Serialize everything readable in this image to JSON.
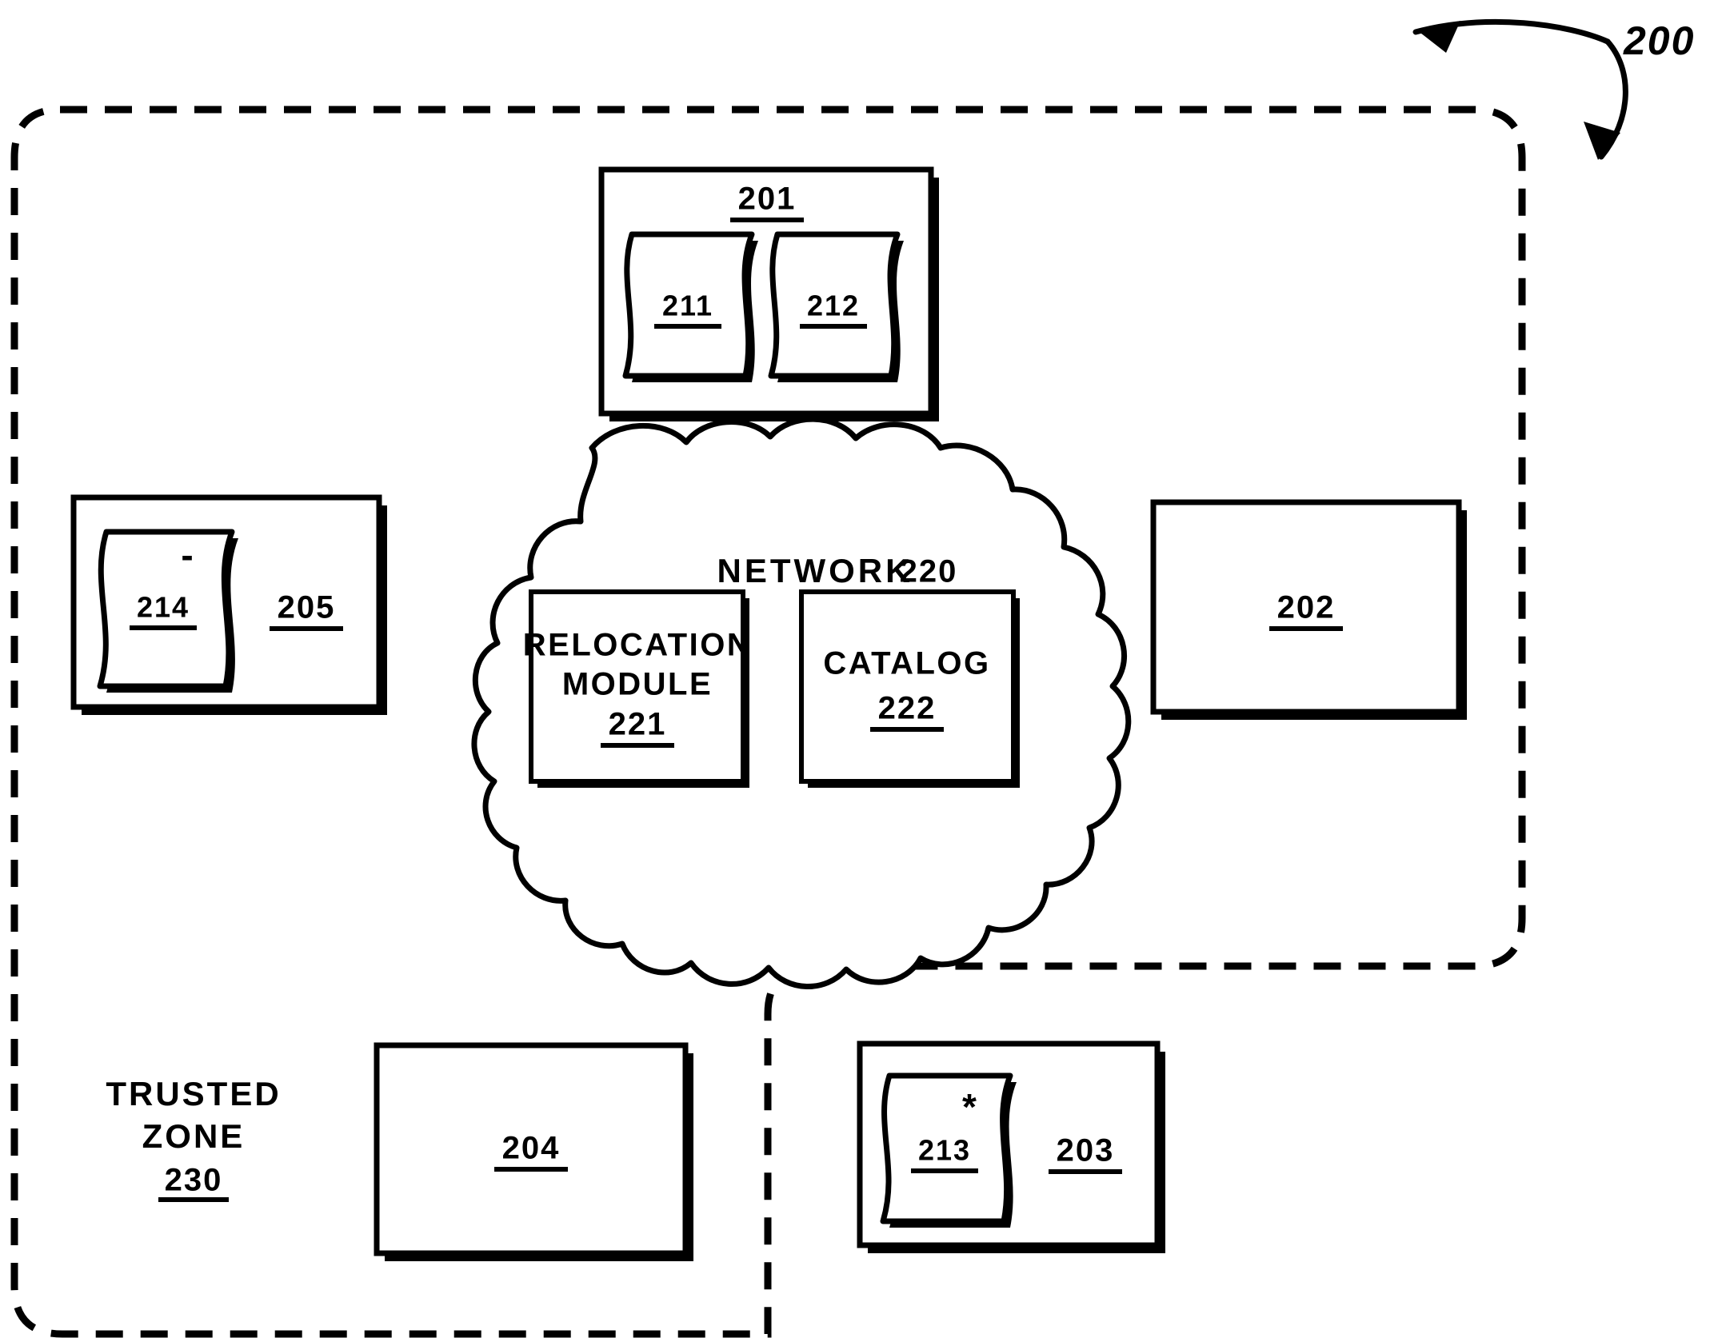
{
  "figure": {
    "figure_number": "200",
    "leader_icon": "curved-double-arrow"
  },
  "trusted_zone": {
    "label_line1": "TRUSTED",
    "label_line2": "ZONE",
    "ref": "230"
  },
  "network_cloud": {
    "title": "NETWORK",
    "ref": "220",
    "modules": [
      {
        "name": "relocation-module",
        "line1": "RELOCATION",
        "line2": "MODULE",
        "ref": "221"
      },
      {
        "name": "catalog-module",
        "line1": "CATALOG",
        "line2": "",
        "ref": "222"
      }
    ]
  },
  "nodes": [
    {
      "name": "node-201",
      "ref": "201",
      "documents": [
        {
          "ref": "211",
          "mark": ""
        },
        {
          "ref": "212",
          "mark": ""
        }
      ]
    },
    {
      "name": "node-205",
      "ref": "205",
      "documents": [
        {
          "ref": "214",
          "mark": "-"
        }
      ]
    },
    {
      "name": "node-202",
      "ref": "202",
      "documents": []
    },
    {
      "name": "node-204",
      "ref": "204",
      "documents": []
    },
    {
      "name": "node-203",
      "ref": "203",
      "documents": [
        {
          "ref": "213",
          "mark": "*"
        }
      ]
    }
  ],
  "colors": {
    "ink": "#000000",
    "paper": "#ffffff"
  }
}
